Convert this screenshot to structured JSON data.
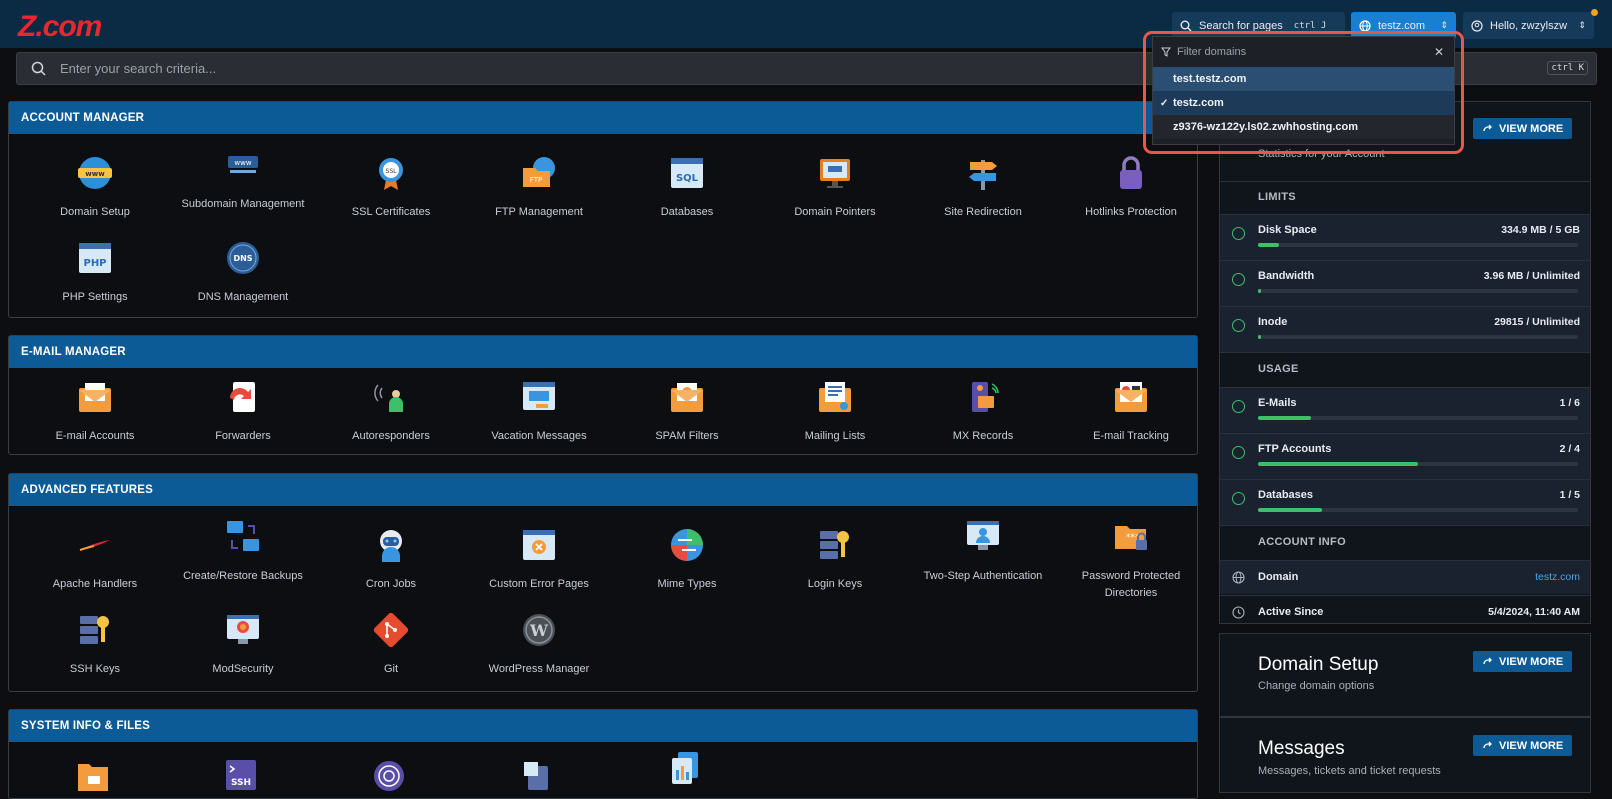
{
  "app": {
    "logo": "Z.com"
  },
  "topbar": {
    "search_pages": "Search for pages",
    "search_pages_kbd": "ctrl J",
    "domain": "testz.com",
    "hello": "Hello, zwzylszw"
  },
  "search": {
    "placeholder": "Enter your search criteria...",
    "kbd": "ctrl K"
  },
  "dropdown": {
    "filter_placeholder": "Filter domains",
    "items": [
      "test.testz.com",
      "testz.com",
      "z9376-wz122y.ls02.zwhhosting.com"
    ],
    "selected": "testz.com"
  },
  "sections": [
    {
      "title": "ACCOUNT MANAGER",
      "items": [
        "Domain Setup",
        "Subdomain Management",
        "SSL Certificates",
        "FTP Management",
        "Databases",
        "Domain Pointers",
        "Site Redirection",
        "Hotlinks Protection",
        "PHP Settings",
        "DNS Management"
      ]
    },
    {
      "title": "E-MAIL MANAGER",
      "items": [
        "E-mail Accounts",
        "Forwarders",
        "Autoresponders",
        "Vacation Messages",
        "SPAM Filters",
        "Mailing Lists",
        "MX Records",
        "E-mail Tracking"
      ]
    },
    {
      "title": "ADVANCED FEATURES",
      "items": [
        "Apache Handlers",
        "Create/Restore Backups",
        "Cron Jobs",
        "Custom Error Pages",
        "Mime Types",
        "Login Keys",
        "Two-Step Authentication",
        "Password Protected Directories",
        "SSH Keys",
        "ModSecurity",
        "Git",
        "WordPress Manager"
      ]
    },
    {
      "title": "SYSTEM INFO & FILES",
      "items": []
    }
  ],
  "stats": {
    "view_more": "VIEW MORE",
    "subtitle": "Statistics for your Account",
    "limits_label": "LIMITS",
    "usage_label": "USAGE",
    "account_info_label": "ACCOUNT INFO",
    "limits": [
      {
        "name": "Disk Space",
        "value": "334.9 MB / 5 GB",
        "fraction": 0.065
      },
      {
        "name": "Bandwidth",
        "value": "3.96 MB / Unlimited",
        "fraction": 0.01
      },
      {
        "name": "Inode",
        "value": "29815 / Unlimited",
        "fraction": 0.01
      }
    ],
    "usage": [
      {
        "name": "E-Mails",
        "value": "1 / 6",
        "fraction": 0.1667
      },
      {
        "name": "FTP Accounts",
        "value": "2 / 4",
        "fraction": 0.5
      },
      {
        "name": "Databases",
        "value": "1 / 5",
        "fraction": 0.2
      }
    ],
    "info": [
      {
        "name": "Domain",
        "value": "testz.com"
      },
      {
        "name": "Active Since",
        "value": "5/4/2024, 11:40 AM"
      }
    ]
  },
  "cards": [
    {
      "title": "Domain Setup",
      "desc": "Change domain options",
      "button": "VIEW MORE"
    },
    {
      "title": "Messages",
      "desc": "Messages, tickets and ticket requests",
      "button": "VIEW MORE"
    }
  ],
  "colors": {
    "accent": "#0c5a96",
    "progress": "#3fbf6a",
    "highlight": "#e45a4a"
  }
}
